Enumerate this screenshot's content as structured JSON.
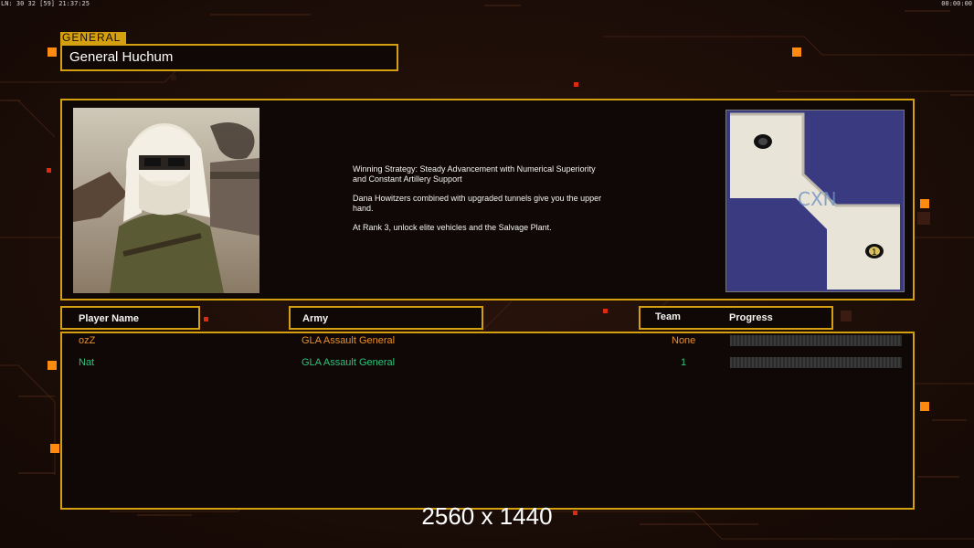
{
  "hud": {
    "left_stats": "LN: 30 32 [59] 21:37:25",
    "right_clock": "00:00:00"
  },
  "general": {
    "section_label": "GENERAL",
    "name": "General Huchum",
    "strategy_paragraphs": [
      "Winning Strategy: Steady Advancement with Numerical Superiority\n and Constant Artillery Support",
      "Dana Howitzers combined with upgraded tunnels give you the upper\n hand.",
      "At Rank 3, unlock elite vehicles and the Salvage Plant."
    ]
  },
  "minimap": {
    "logo_text": "CXN",
    "start_marker_label": "1"
  },
  "table": {
    "headers": {
      "player_name": "Player Name",
      "army": "Army",
      "team": "Team",
      "progress": "Progress"
    },
    "rows": [
      {
        "player": "ozZ",
        "army": "GLA Assault General",
        "team": "None",
        "color": "#e8902c",
        "progress": 0
      },
      {
        "player": "Nat",
        "army": "GLA Assault General",
        "team": "1",
        "color": "#2ec27a",
        "progress": 0
      }
    ]
  },
  "overlay": {
    "resolution_watermark": "2560 x 1440"
  },
  "colors": {
    "frame_gold": "#d4a010",
    "background": "#1a0d08",
    "accent_orange": "#ff8a10"
  }
}
